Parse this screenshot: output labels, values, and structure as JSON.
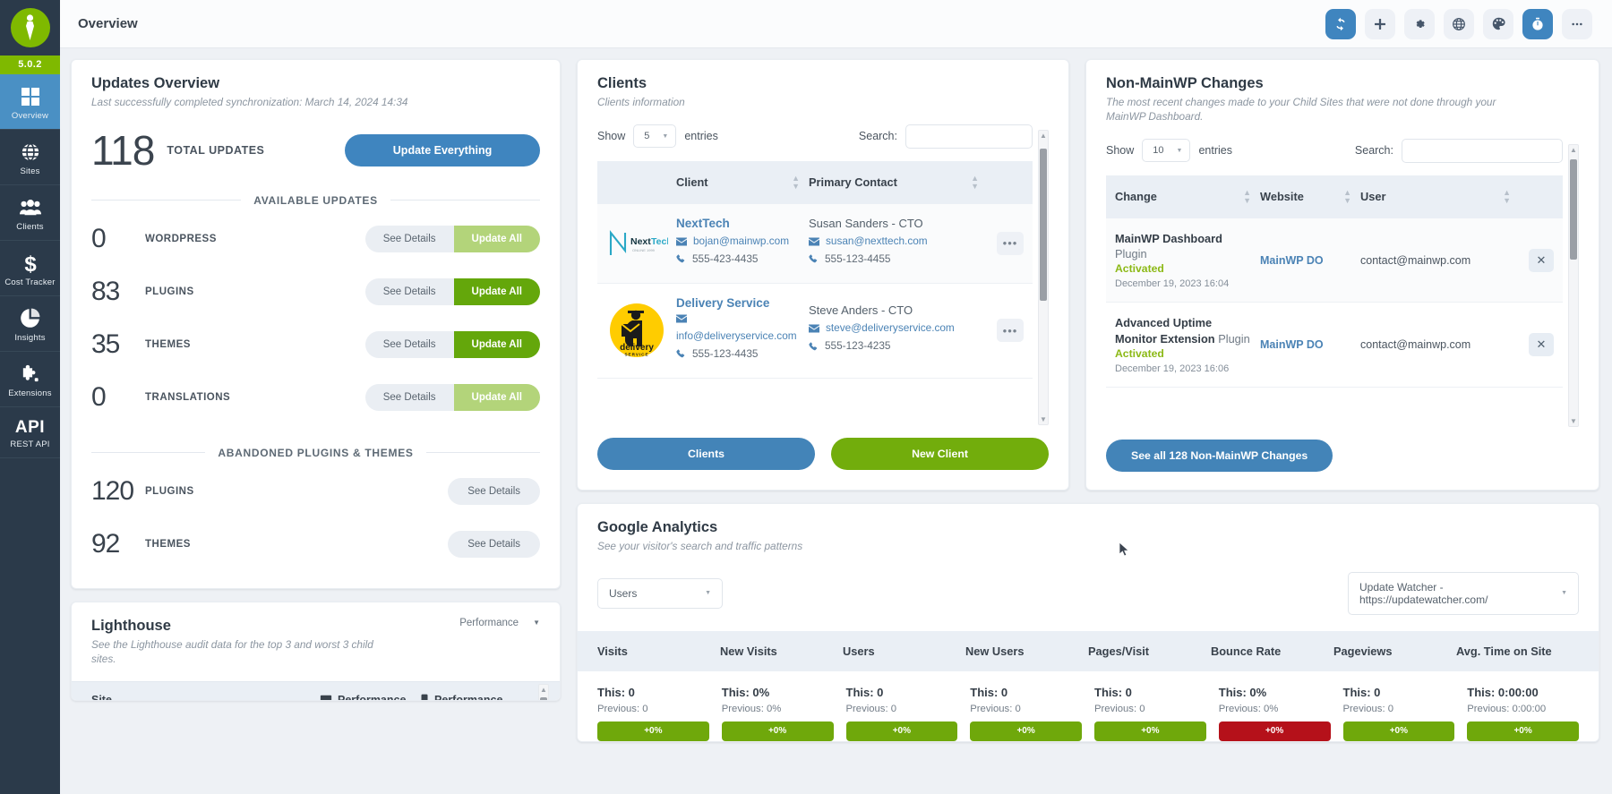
{
  "sidebar": {
    "version": "5.0.2",
    "items": [
      {
        "icon": "grid-icon",
        "label": "Overview",
        "active": true
      },
      {
        "icon": "globe-icon",
        "label": "Sites",
        "active": false
      },
      {
        "icon": "users-icon",
        "label": "Clients",
        "active": false
      },
      {
        "icon": "dollar-icon",
        "label": "Cost Tracker",
        "active": false
      },
      {
        "icon": "pie-chart-icon",
        "label": "Insights",
        "active": false
      },
      {
        "icon": "puzzle-icon",
        "label": "Extensions",
        "active": false
      },
      {
        "icon": "api-text",
        "label": "REST API",
        "api_text": "API",
        "active": false
      }
    ]
  },
  "header": {
    "title": "Overview",
    "icons": [
      {
        "name": "sync-icon",
        "active": true
      },
      {
        "name": "plus-icon",
        "active": false
      },
      {
        "name": "gear-icon",
        "active": false
      },
      {
        "name": "globe-icon",
        "active": false
      },
      {
        "name": "palette-icon",
        "active": false
      },
      {
        "name": "timer-icon",
        "active": true
      },
      {
        "name": "more-icon",
        "active": false
      }
    ]
  },
  "updates_overview": {
    "title": "Updates Overview",
    "subtitle": "Last successfully completed synchronization: March 14, 2024 14:34",
    "total_count": "118",
    "total_label": "TOTAL UPDATES",
    "update_everything_label": "Update Everything",
    "available_divider": "AVAILABLE UPDATES",
    "available": [
      {
        "count": "0",
        "label": "WORDPRESS",
        "see_details": "See Details",
        "update_all": "Update All",
        "enabled": false
      },
      {
        "count": "83",
        "label": "PLUGINS",
        "see_details": "See Details",
        "update_all": "Update All",
        "enabled": true
      },
      {
        "count": "35",
        "label": "THEMES",
        "see_details": "See Details",
        "update_all": "Update All",
        "enabled": true
      },
      {
        "count": "0",
        "label": "TRANSLATIONS",
        "see_details": "See Details",
        "update_all": "Update All",
        "enabled": false
      }
    ],
    "abandoned_divider": "ABANDONED PLUGINS & THEMES",
    "abandoned": [
      {
        "count": "120",
        "label": "PLUGINS",
        "see_details": "See Details"
      },
      {
        "count": "92",
        "label": "THEMES",
        "see_details": "See Details"
      }
    ]
  },
  "lighthouse": {
    "title": "Lighthouse",
    "subtitle": "See the Lighthouse audit data for the top 3 and worst 3 child sites.",
    "selector": "Performance",
    "columns": [
      "Site",
      "Performance",
      "Performance"
    ]
  },
  "clients": {
    "title": "Clients",
    "subtitle": "Clients information",
    "show_label": "Show",
    "entries_label": "entries",
    "page_size": "5",
    "search_label": "Search:",
    "search_value": "",
    "search_placeholder": "",
    "columns": [
      "Client",
      "Primary Contact"
    ],
    "rows": [
      {
        "logo": "nexttech-logo",
        "name": "NextTech",
        "email": "bojan@mainwp.com",
        "phone": "555-423-4435",
        "contact_name": "Susan Sanders - CTO",
        "contact_email": "susan@nexttech.com",
        "contact_phone": "555-123-4455"
      },
      {
        "logo": "delivery-service-logo",
        "name": "Delivery Service",
        "email": "info@deliveryservice.com",
        "phone": "555-123-4435",
        "contact_name": "Steve Anders - CTO",
        "contact_email": "steve@deliveryservice.com",
        "contact_phone": "555-123-4235"
      }
    ],
    "btn_clients": "Clients",
    "btn_new_client": "New Client"
  },
  "non_mainwp": {
    "title": "Non-MainWP Changes",
    "subtitle": "The most recent changes made to your Child Sites that were not done through your MainWP Dashboard.",
    "show_label": "Show",
    "entries_label": "entries",
    "page_size": "10",
    "search_label": "Search:",
    "search_value": "",
    "columns": [
      "Change",
      "Website",
      "User"
    ],
    "rows": [
      {
        "change_title": "MainWP Dashboard",
        "change_type": "Plugin",
        "status": "Activated",
        "date": "December 19, 2023 16:04",
        "website": "MainWP DO",
        "user": "contact@mainwp.com"
      },
      {
        "change_title": "Advanced Uptime Monitor Extension",
        "change_type": "Plugin",
        "status": "Activated",
        "date": "December 19, 2023 16:06",
        "website": "MainWP DO",
        "user": "contact@mainwp.com"
      }
    ],
    "see_all_label": "See all 128 Non-MainWP Changes"
  },
  "google_analytics": {
    "title": "Google Analytics",
    "subtitle": "See your visitor's search and traffic patterns",
    "metric_selector": "Users",
    "site_selector": "Update Watcher - https://updatewatcher.com/",
    "columns": [
      "Visits",
      "New Visits",
      "Users",
      "New Users",
      "Pages/Visit",
      "Bounce Rate",
      "Pageviews",
      "Avg. Time on Site"
    ],
    "metrics": [
      {
        "label": "Visits",
        "this": "This: 0",
        "previous": "Previous: 0",
        "delta": "+0%",
        "negative": false
      },
      {
        "label": "New Visits",
        "this": "This: 0%",
        "previous": "Previous: 0%",
        "delta": "+0%",
        "negative": false
      },
      {
        "label": "Users",
        "this": "This: 0",
        "previous": "Previous: 0",
        "delta": "+0%",
        "negative": false
      },
      {
        "label": "New Users",
        "this": "This: 0",
        "previous": "Previous: 0",
        "delta": "+0%",
        "negative": false
      },
      {
        "label": "Pages/Visit",
        "this": "This: 0",
        "previous": "Previous: 0",
        "delta": "+0%",
        "negative": false
      },
      {
        "label": "Bounce Rate",
        "this": "This: 0%",
        "previous": "Previous: 0%",
        "delta": "+0%",
        "negative": true
      },
      {
        "label": "Pageviews",
        "this": "This: 0",
        "previous": "Previous: 0",
        "delta": "+0%",
        "negative": false
      },
      {
        "label": "Avg. Time on Site",
        "this": "This: 0:00:00",
        "previous": "Previous: 0:00:00",
        "delta": "+0%",
        "negative": false
      }
    ]
  },
  "colors": {
    "brand_green": "#7fb900",
    "accent_blue": "#3f85bf",
    "sidebar_bg": "#2b3a4a",
    "status_green": "#8cb916",
    "negative_red": "#b5111a"
  }
}
